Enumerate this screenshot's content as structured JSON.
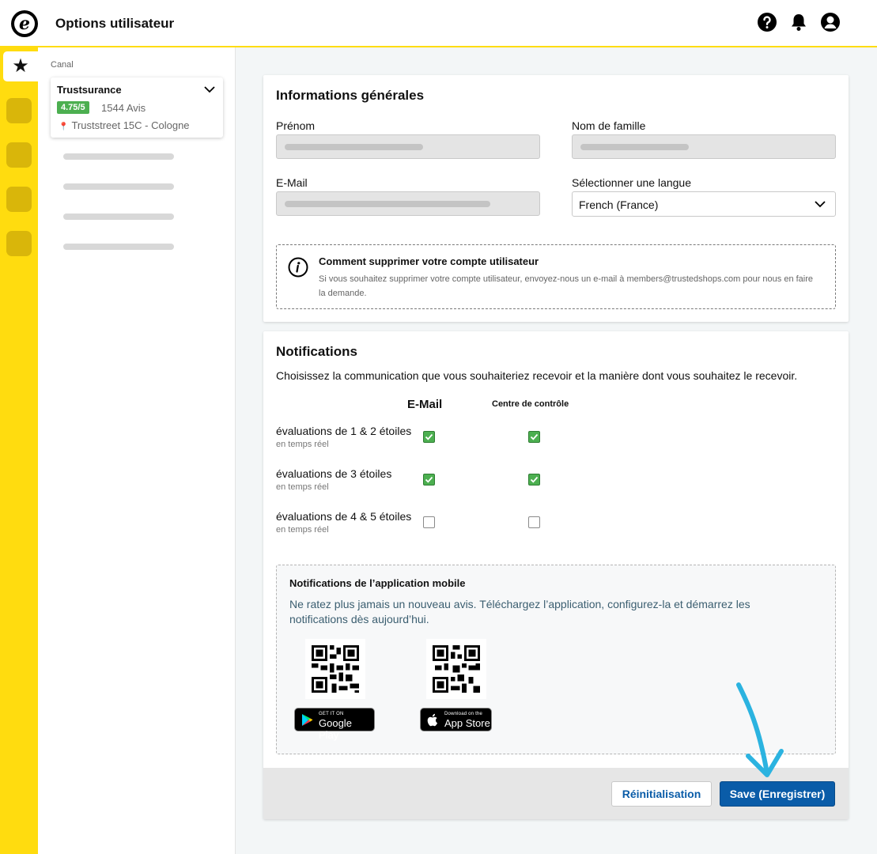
{
  "header": {
    "title": "Options utilisateur",
    "logo_letter": "e"
  },
  "colors": {
    "accent_yellow": "#ffdc0f",
    "primary_blue": "#0a5ca8",
    "success_green": "#4caf50",
    "annotation_arrow": "#2bb3e0"
  },
  "icons": {
    "help": "help-circle-icon",
    "notifications": "bell-icon",
    "account": "user-circle-icon",
    "rail_active": "star-icon"
  },
  "sidebar": {
    "section_label": "Canal",
    "shop": {
      "name": "Trustsurance",
      "rating": "4.75/5",
      "reviews": "1544 Avis",
      "address": "Truststreet 15C - Cologne"
    }
  },
  "general": {
    "title": "Informations générales",
    "first_name_label": "Prénom",
    "last_name_label": "Nom de famille",
    "email_label": "E-Mail",
    "language_label": "Sélectionner une langue",
    "language_value": "French (France)",
    "info_title": "Comment supprimer votre compte utilisateur",
    "info_text": "Si vous souhaitez supprimer votre compte utilisateur, envoyez-nous un e-mail à members@trustedshops.com pour nous en faire la demande."
  },
  "notifications": {
    "title": "Notifications",
    "description": "Choisissez la communication que vous souhaiteriez recevoir et la manière dont vous souhaitez le recevoir.",
    "col_email": "E-Mail",
    "col_control": "Centre de contrôle",
    "rows": [
      {
        "label": "évaluations de 1 & 2 étoiles",
        "sub": "en temps réel",
        "email": true,
        "control": true
      },
      {
        "label": "évaluations de 3 étoiles",
        "sub": "en temps réel",
        "email": true,
        "control": true
      },
      {
        "label": "évaluations de 4 & 5 étoiles",
        "sub": "en temps réel",
        "email": false,
        "control": false
      }
    ],
    "mobile": {
      "title": "Notifications de l’application mobile",
      "text": "Ne ratez plus jamais un nouveau avis. Téléchargez l’application, configurez-la et démarrez les notifications dès aujourd’hui.",
      "google": {
        "small": "GET IT ON",
        "big": "Google Play"
      },
      "apple": {
        "small": "Download on the",
        "big": "App Store"
      }
    }
  },
  "actions": {
    "reset_label": "Réinitialisation",
    "save_label": "Save (Enregistrer)"
  }
}
